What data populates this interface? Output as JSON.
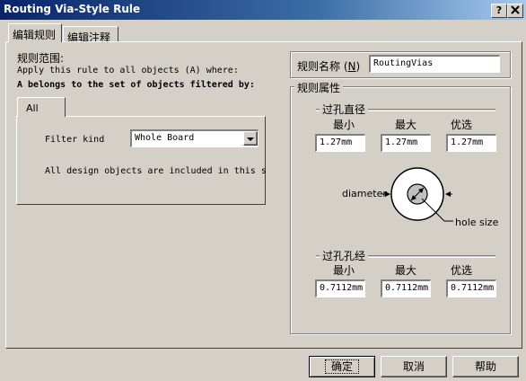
{
  "window": {
    "title": "Routing Via-Style Rule",
    "help_btn": "?",
    "close_btn": "X"
  },
  "tabs": [
    {
      "label": "编辑规则"
    },
    {
      "label": "编辑注释"
    }
  ],
  "scope": {
    "heading": "规则范围:",
    "apply_text": "Apply this rule to all objects (A) where:",
    "belongs_text": "A belongs to the set of objects filtered by:",
    "inner_tab": "All",
    "filter_label": "Filter kind",
    "filter_value": "Whole Board",
    "description": "All design objects are included in this s"
  },
  "rule_name": {
    "label": "规则名称",
    "accel": "N",
    "value": "RoutingVias"
  },
  "props": {
    "heading": "规则属性",
    "diameter_group": {
      "title": "过孔直径",
      "min_label": "最小",
      "max_label": "最大",
      "pref_label": "优选",
      "min": "1.27mm",
      "max": "1.27mm",
      "pref": "1.27mm"
    },
    "diagram": {
      "diameter_label": "diameter",
      "hole_label": "hole size"
    },
    "hole_group": {
      "title": "过孔孔经",
      "min_label": "最小",
      "max_label": "最大",
      "pref_label": "优选",
      "min": "0.7112mm",
      "max": "0.7112mm",
      "pref": "0.7112mm"
    }
  },
  "buttons": {
    "ok": "确定",
    "cancel": "取消",
    "help": "帮助"
  }
}
